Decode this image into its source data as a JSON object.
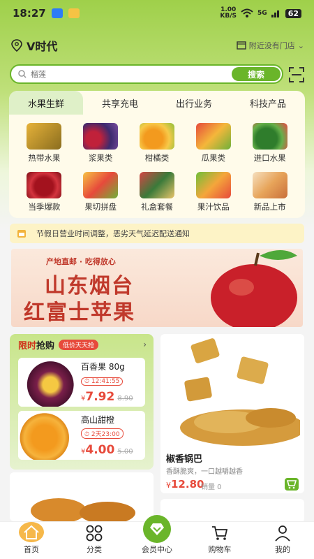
{
  "status": {
    "time": "18:27",
    "net": "1.00\nKB/S",
    "signal": "5G",
    "battery": "62"
  },
  "location": {
    "name": "V时代",
    "store": "附近没有门店"
  },
  "search": {
    "placeholder": "榴莲",
    "button": "搜索"
  },
  "tabs": [
    "水果生鲜",
    "共享充电",
    "出行业务",
    "科技产品"
  ],
  "categories": [
    "热带水果",
    "浆果类",
    "柑橘类",
    "瓜果类",
    "进口水果",
    "当季爆款",
    "果切拼盘",
    "礼盒套餐",
    "果汁饮品",
    "新品上市"
  ],
  "notice": {
    "text": "节假日营业时间调整，恶劣天气延迟配送通知"
  },
  "banner": {
    "sub": "产地直邮 · 吃得放心",
    "line1": "山东烟台",
    "line2": "红富士苹果"
  },
  "flash": {
    "title_red": "限时",
    "title_black": "抢购",
    "badge": "低价天天抢",
    "items": [
      {
        "name": "百香果 80g",
        "timer": "12:41:55",
        "price": "7.92",
        "old": "8.90",
        "currency": "¥"
      },
      {
        "name": "高山甜橙",
        "timer": "2天23:00",
        "price": "4.00",
        "old": "5.00",
        "currency": "¥"
      }
    ]
  },
  "product": {
    "name": "椒香锅巴",
    "desc": "香酥脆爽，一口越嚼越香",
    "price": "12.80",
    "currency": "¥",
    "sold": "销量 0"
  },
  "nav": [
    "首页",
    "分类",
    "会员中心",
    "购物车",
    "我的"
  ],
  "colors": {
    "accent": "#6ab52a",
    "price": "#e74a3b",
    "home": "#f6b84a"
  }
}
